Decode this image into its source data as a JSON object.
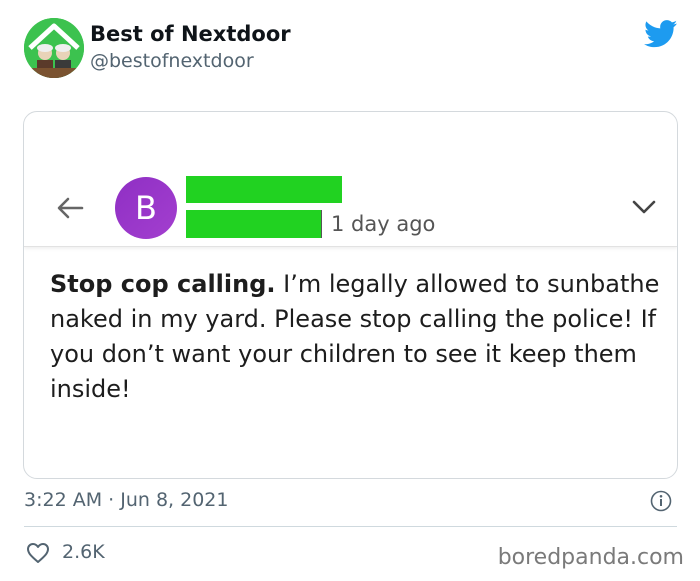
{
  "author": {
    "name": "Best of Nextdoor",
    "handle": "@bestofnextdoor",
    "avatar_color": "#3cc24f"
  },
  "twitter_icon": "twitter-bird-icon",
  "embedded_post": {
    "avatar_letter": "B",
    "avatar_color": "#9b35cb",
    "redaction_color": "#21d221",
    "time_ago": "1 day ago",
    "title": "Stop cop calling.",
    "body": " I’m legally allowed to sunbathe naked in my yard. Please stop calling the police! If you don’t want your children to see it keep them inside!"
  },
  "footer": {
    "timestamp": "3:22 AM · Jun 8, 2021",
    "likes": "2.6K"
  },
  "watermark": "boredpanda.com",
  "colors": {
    "twitter_blue": "#1d9bf0",
    "secondary_text": "#536471"
  }
}
